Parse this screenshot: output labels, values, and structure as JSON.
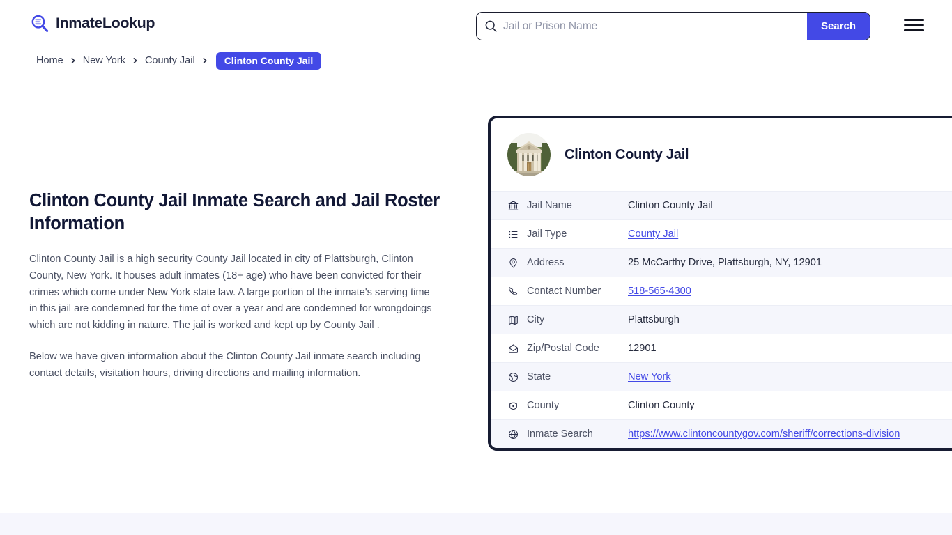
{
  "header": {
    "brand_name": "InmateLookup",
    "brand_icon": "magnifier-list-icon",
    "menu_icon": "hamburger-menu-icon"
  },
  "search": {
    "icon": "search-icon",
    "placeholder": "Jail or Prison Name",
    "value": "",
    "button_label": "Search"
  },
  "breadcrumb": {
    "separator": "›",
    "items": [
      {
        "label": "Home"
      },
      {
        "label": "New York"
      },
      {
        "label": "County Jail"
      }
    ],
    "current": "Clinton County Jail"
  },
  "main": {
    "title": "Clinton County Jail Inmate Search and Jail Roster Information",
    "paragraphs": [
      "Clinton County Jail is a high security County Jail located in city of Plattsburgh, Clinton County, New York. It houses adult inmates (18+ age) who have been convicted for their crimes which come under New York state law. A large portion of the inmate's serving time in this jail are condemned for the time of over a year and are condemned for wrongdoings which are not kidding in nature. The jail is worked and kept up by County Jail .",
      "Below we have given information about the Clinton County Jail inmate search including contact details, visitation hours, driving directions and mailing information."
    ]
  },
  "card": {
    "avatar_icon": "courthouse-building-photo",
    "title": "Clinton County Jail",
    "rows": [
      {
        "icon": "bank-building-icon",
        "label": "Jail Name",
        "value": "Clinton County Jail",
        "link": false
      },
      {
        "icon": "list-icon",
        "label": "Jail Type",
        "value": "County Jail",
        "link": true
      },
      {
        "icon": "map-pin-icon",
        "label": "Address",
        "value": "25 McCarthy Drive, Plattsburgh, NY, 12901",
        "link": false
      },
      {
        "icon": "phone-icon",
        "label": "Contact Number",
        "value": "518-565-4300",
        "link": true
      },
      {
        "icon": "map-icon",
        "label": "City",
        "value": "Plattsburgh",
        "link": false
      },
      {
        "icon": "envelope-icon",
        "label": "Zip/Postal Code",
        "value": "12901",
        "link": false
      },
      {
        "icon": "globe-icon",
        "label": "State",
        "value": "New York",
        "link": true
      },
      {
        "icon": "badge-icon",
        "label": "County",
        "value": "Clinton County",
        "link": false
      },
      {
        "icon": "web-globe-icon",
        "label": "Inmate Search",
        "value": "https://www.clintoncountygov.com/sheriff/corrections-division",
        "link": true
      }
    ]
  },
  "colors": {
    "accent_blue": "#4349e6",
    "card_border": "#171c33",
    "row_alt_bg": "#f5f6fc",
    "footer_band": "#f6f6fd",
    "heading": "#111735",
    "body_text": "#4a5063"
  }
}
